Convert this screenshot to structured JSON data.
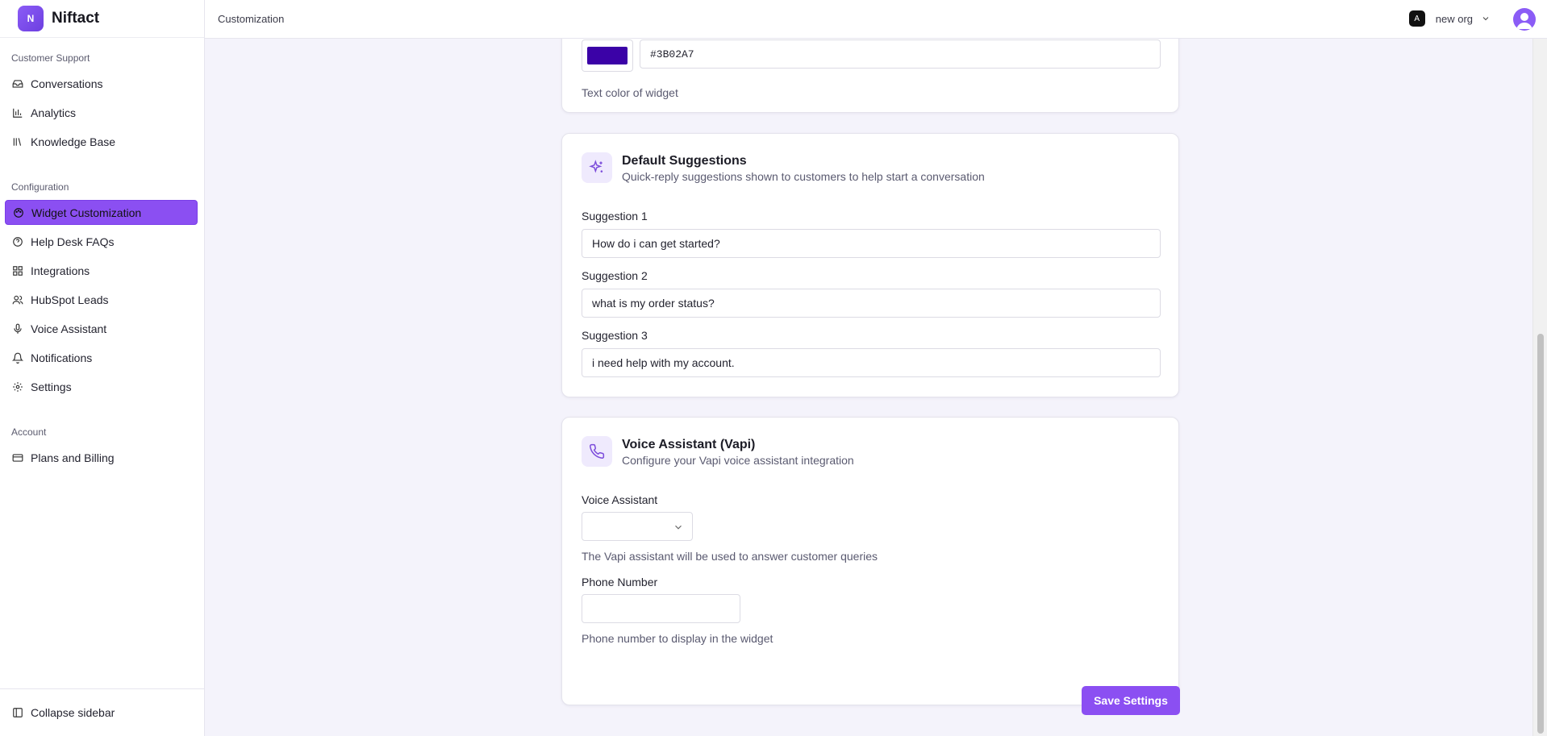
{
  "brand": {
    "logo_text": "N",
    "name": "Niftact"
  },
  "header": {
    "title": "Customization",
    "org_name": "new org",
    "org_icon_text": "A"
  },
  "sidebar": {
    "sections": [
      {
        "label": "Customer Support"
      },
      {
        "label": "Configuration"
      },
      {
        "label": "Account"
      }
    ],
    "items": [
      {
        "label": "Conversations",
        "icon": "inbox-icon"
      },
      {
        "label": "Analytics",
        "icon": "bar-chart-icon"
      },
      {
        "label": "Knowledge Base",
        "icon": "library-icon"
      },
      {
        "label": "Widget Customization",
        "icon": "palette-icon",
        "active": true
      },
      {
        "label": "Help Desk FAQs",
        "icon": "help-circle-icon"
      },
      {
        "label": "Integrations",
        "icon": "grid-icon"
      },
      {
        "label": "HubSpot Leads",
        "icon": "users-icon"
      },
      {
        "label": "Voice Assistant",
        "icon": "mic-icon"
      },
      {
        "label": "Notifications",
        "icon": "bell-icon"
      },
      {
        "label": "Settings",
        "icon": "gear-icon"
      },
      {
        "label": "Plans and Billing",
        "icon": "credit-card-icon"
      }
    ],
    "collapse_label": "Collapse sidebar"
  },
  "text_color_card": {
    "hex_value": "#3B02A7",
    "swatch_color": "#3B02A7",
    "hint": "Text color of widget"
  },
  "suggestions_card": {
    "title": "Default Suggestions",
    "description": "Quick-reply suggestions shown to customers to help start a conversation",
    "fields": [
      {
        "label": "Suggestion 1",
        "value": "How do i can get started?"
      },
      {
        "label": "Suggestion 2",
        "value": "what is my order status?"
      },
      {
        "label": "Suggestion 3",
        "value": "i need help with my account."
      }
    ]
  },
  "voice_card": {
    "title": "Voice Assistant (Vapi)",
    "description": "Configure your Vapi voice assistant integration",
    "assistant_label": "Voice Assistant",
    "assistant_hint": "The Vapi assistant will be used to answer customer queries",
    "phone_label": "Phone Number",
    "phone_hint": "Phone number to display in the widget"
  },
  "save_label": "Save Settings",
  "colors": {
    "accent": "#8B4FF2",
    "accent_light": "#EFEAFD"
  }
}
